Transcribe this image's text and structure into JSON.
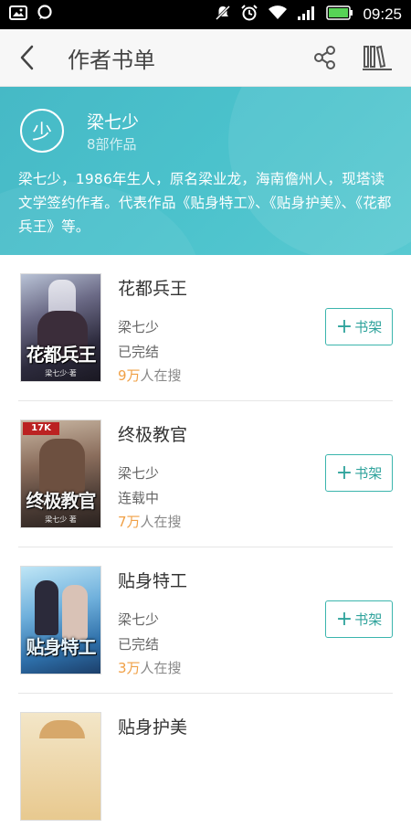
{
  "status_bar": {
    "time": "09:25",
    "icons": [
      "image-icon",
      "message-icon",
      "mute-icon",
      "alarm-icon",
      "wifi-icon",
      "signal-icon",
      "battery-icon"
    ]
  },
  "header": {
    "title": "作者书单",
    "back_icon": "chevron-left-icon",
    "share_icon": "share-icon",
    "shelf_icon": "bookshelf-icon"
  },
  "author": {
    "avatar_char": "少",
    "name": "梁七少",
    "works_count": "8部作品",
    "description": "梁七少，1986年生人，原名梁业龙，海南儋州人，现塔读文学签约作者。代表作品《贴身特工》、《贴身护美》、《花都兵王》等。"
  },
  "books": [
    {
      "title": "花都兵王",
      "author": "梁七少",
      "status": "已完结",
      "search_num": "9万",
      "search_suffix": "人在搜",
      "button": "书架",
      "cover_text": "花都兵王",
      "cover_author": "梁七少·著"
    },
    {
      "title": "终极教官",
      "author": "梁七少",
      "status": "连载中",
      "search_num": "7万",
      "search_suffix": "人在搜",
      "button": "书架",
      "cover_text": "终极教官",
      "cover_author": "梁七少 著"
    },
    {
      "title": "贴身特工",
      "author": "梁七少",
      "status": "已完结",
      "search_num": "3万",
      "search_suffix": "人在搜",
      "button": "书架",
      "cover_text": "贴身特工",
      "cover_author": ""
    },
    {
      "title": "贴身护美",
      "author": "",
      "status": "",
      "search_num": "",
      "search_suffix": "",
      "button": "",
      "cover_text": "",
      "cover_author": ""
    }
  ],
  "colors": {
    "accent": "#3bb5ad",
    "panel": "#4bc0cb",
    "search_num": "#f0a046"
  }
}
